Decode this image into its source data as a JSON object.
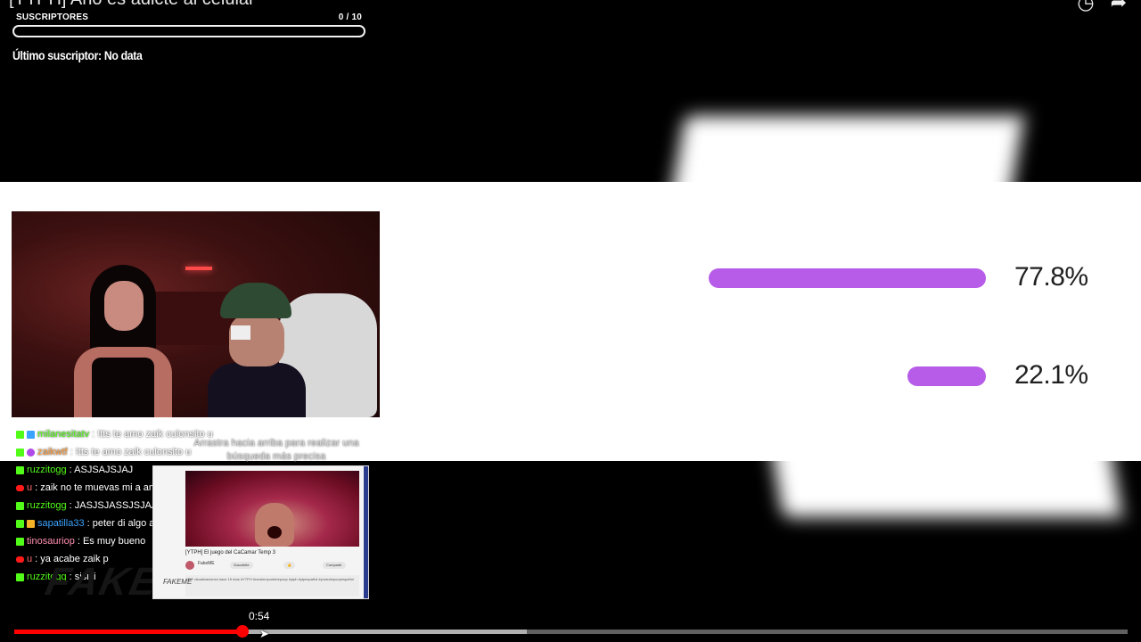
{
  "video": {
    "title": "[YTPH] Año es adicte al celular",
    "current_time": "0:54",
    "played_fraction": 0.205,
    "buffered_fraction": 0.46
  },
  "top_icons": [
    "clock-icon",
    "share-icon"
  ],
  "subscribers": {
    "label": "SUSCRIPTORES",
    "count": "0 / 10",
    "fraction": 0,
    "last_label": "Último suscriptor: No data"
  },
  "poll": {
    "options": [
      {
        "percent_label": "77.8%",
        "value": 77.8
      },
      {
        "percent_label": "22.1%",
        "value": 22.1
      }
    ],
    "bar_color": "#b65ce8"
  },
  "chat": {
    "messages": [
      {
        "badges": [
          "kick",
          "blue"
        ],
        "user": "milanesitatv",
        "user_color": "#53fc18",
        "text": ": !tts te amo zaik culonsito u"
      },
      {
        "badges": [
          "kick",
          "purple"
        ],
        "user": "zaikwtf",
        "user_color": "#ff9e3d",
        "text": ": !tts te amo zaik culonsito u"
      },
      {
        "badges": [
          "kick"
        ],
        "user": "ruzzitogg",
        "user_color": "#53fc18",
        "text": ": ASJSAJSJAJ"
      },
      {
        "badges": [
          "yt"
        ],
        "user": "u",
        "user_color": "#ff6a6a",
        "text": ": zaik no te muevas mi a amor que ya casi acabo"
      },
      {
        "badges": [
          "kick"
        ],
        "user": "ruzzitogg",
        "user_color": "#53fc18",
        "text": ": JASJSJASSJSJAAJS"
      },
      {
        "badges": [
          "kick",
          "gold"
        ],
        "user": "sapatilla33",
        "user_color": "#3aa3ff",
        "text": ": peter di algo algo"
      },
      {
        "badges": [
          "kick"
        ],
        "user": "tinosauriop",
        "user_color": "#ff8fb0",
        "text": ": Es muy bueno"
      },
      {
        "badges": [
          "yt"
        ],
        "user": "u",
        "user_color": "#ff6a6a",
        "text": ": ya acabe zaik p"
      },
      {
        "badges": [
          "kick"
        ],
        "user": "ruzzitogg",
        "user_color": "#53fc18",
        "text": ": sisisi"
      }
    ],
    "hint": "Arrastra hacia arriba para realizar una búsqueda más precisa"
  },
  "thumbnail": {
    "title": "[YTPH] El juego del CaCamar Temp 3",
    "channel": "FakeME",
    "subscribe": "Suscribite",
    "share": "Compartir",
    "meta": "397 visualizaciones hace 15 días #YTPH #randomyoutubepoop #ytph #ytpespañol #youtubepoopespañol",
    "watermark": "FAKEME"
  },
  "logo": {
    "text": "FAKEME"
  },
  "colors": {
    "progress_played": "#ff0000",
    "progress_buffer": "#b0b0b0",
    "kick_green": "#53fc18",
    "youtube_red": "#ff1a1a"
  }
}
